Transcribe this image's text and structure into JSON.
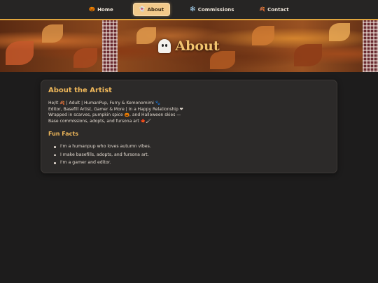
{
  "nav": {
    "items": [
      {
        "label": "Home",
        "icon": "🎃",
        "active": false
      },
      {
        "label": "About",
        "icon": "👻",
        "active": true
      },
      {
        "label": "Commissions",
        "icon": "❄️",
        "active": false
      },
      {
        "label": "Contact",
        "icon": "🍂",
        "active": false
      }
    ]
  },
  "banner": {
    "title": "About",
    "icon": "ghost-icon"
  },
  "about": {
    "heading": "About the Artist",
    "bio_lines": [
      "He/It 🍂 | Adult | HumanPup, Furry & Kemonomimi 🐾",
      "Editor, Basefill Artist, Gamer & More | In a Happy Relationship ❤",
      "Wrapped in scarves, pumpkin spice 🎃, and Halloween skies —",
      "Base commissions, adopts, and fursona art 🍁🖌"
    ],
    "fun_facts_heading": "Fun Facts",
    "fun_facts": [
      "I'm a humanpup who loves autumn vibes.",
      "I make basefills, adopts, and fursona art.",
      "I'm a gamer and editor."
    ]
  },
  "colors": {
    "accent": "#f0b85a",
    "nav_active_bg": "#f2c98a",
    "page_bg": "#1d1c1c",
    "card_bg": "#2c2a29"
  }
}
